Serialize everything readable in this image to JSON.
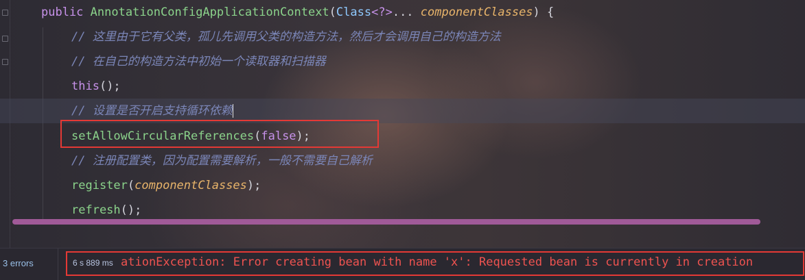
{
  "code": {
    "signature": {
      "public_kw": "public",
      "constructor_name": "AnnotationConfigApplicationContext",
      "open_paren": "(",
      "class_type": "Class",
      "generic": "<?>",
      "varargs": "... ",
      "param_name": "componentClasses",
      "close": ") {"
    },
    "comment1": "// 这里由于它有父类，孤儿先调用父类的构造方法，然后才会调用自己的构造方法",
    "comment2": "// 在自己的构造方法中初始一个读取器和扫描器",
    "this_kw": "this",
    "this_rest": "();",
    "comment3": "// 设置是否开启支持循环依赖",
    "set_method": "setAllowCircularReferences",
    "set_open": "(",
    "set_arg": "false",
    "set_close": ");",
    "comment4": "// 注册配置类，因为配置需要解析，一般不需要自己解析",
    "register_method": "register",
    "register_open": "(",
    "register_arg": "componentClasses",
    "register_close": ");",
    "refresh_method": "refresh",
    "refresh_rest": "();"
  },
  "statusbar": {
    "errors": "3 errors",
    "timing": "6 s 889 ms",
    "console_message": "ationException: Error creating bean with name 'x': Requested bean is currently in creation"
  },
  "colors": {
    "highlight_box": "#e53935",
    "scrollbar_thumb": "#a05a98",
    "error_text": "#ef5350"
  }
}
